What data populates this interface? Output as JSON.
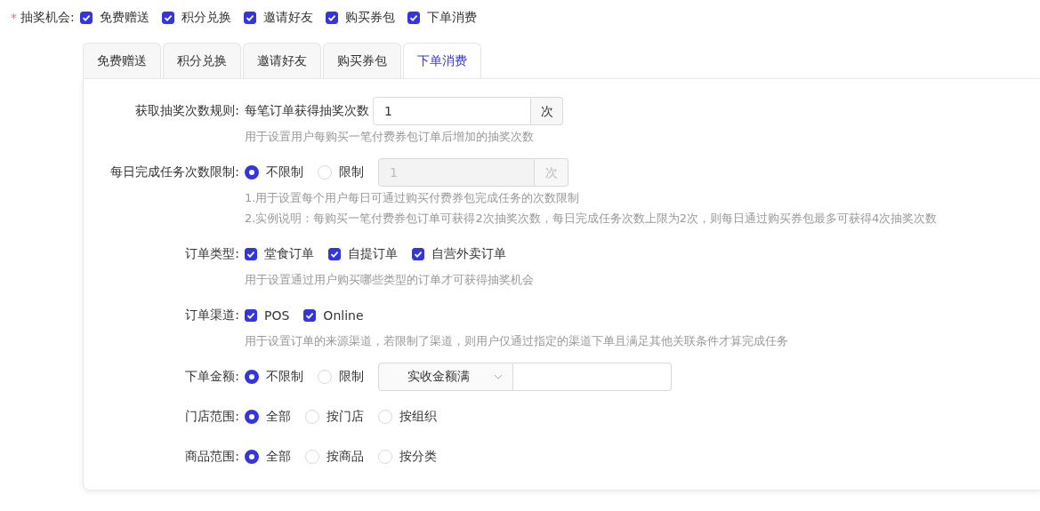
{
  "lottery": {
    "label": "抽奖机会:",
    "required_mark": "*",
    "options": [
      {
        "label": "免费赠送",
        "checked": true
      },
      {
        "label": "积分兑换",
        "checked": true
      },
      {
        "label": "邀请好友",
        "checked": true
      },
      {
        "label": "购买券包",
        "checked": true
      },
      {
        "label": "下单消费",
        "checked": true
      }
    ]
  },
  "tabs": [
    {
      "label": "免费赠送",
      "selected": false
    },
    {
      "label": "积分兑换",
      "selected": false
    },
    {
      "label": "邀请好友",
      "selected": false
    },
    {
      "label": "购买券包",
      "selected": false
    },
    {
      "label": "下单消费",
      "selected": true
    }
  ],
  "rows": [
    {
      "kind": "text",
      "label": "获取抽奖次数规则:",
      "prefix": "每笔订单获得抽奖次数",
      "input": {
        "value": "1",
        "suffix": "次",
        "disabled": false
      },
      "help": [
        "用于设置用户每购买一笔付费券包订单后增加的抽奖次数"
      ]
    },
    {
      "kind": "radio",
      "label": "每日完成任务次数限制:",
      "options": [
        {
          "label": "不限制",
          "selected": true
        },
        {
          "label": "限制",
          "selected": false
        }
      ],
      "input": {
        "value": "1",
        "suffix": "次",
        "disabled": true
      },
      "help": [
        "1.用于设置每个用户每日可通过购买付费券包完成任务的次数限制",
        "2.实例说明：每购买一笔付费券包订单可获得2次抽奖次数，每日完成任务次数上限为2次，则每日通过购买券包最多可获得4次抽奖次数"
      ]
    },
    {
      "kind": "checkbox",
      "label": "订单类型:",
      "options": [
        {
          "label": "堂食订单",
          "checked": true
        },
        {
          "label": "自提订单",
          "checked": true
        },
        {
          "label": "自营外卖订单",
          "checked": true
        }
      ],
      "help": [
        "用于设置通过用户购买哪些类型的订单才可获得抽奖机会"
      ]
    },
    {
      "kind": "checkbox",
      "label": "订单渠道:",
      "options": [
        {
          "label": "POS",
          "checked": true
        },
        {
          "label": "Online",
          "checked": true
        }
      ],
      "help": [
        "用于设置订单的来源渠道，若限制了渠道，则用户仅通过指定的渠道下单且满足其他关联条件才算完成任务"
      ]
    },
    {
      "kind": "radio",
      "label": "下单金额:",
      "options": [
        {
          "label": "不限制",
          "selected": true
        },
        {
          "label": "限制",
          "selected": false
        }
      ],
      "select": {
        "value": "实收金额满"
      },
      "amount": {
        "disabled": false
      }
    },
    {
      "kind": "radio",
      "label": "门店范围:",
      "options": [
        {
          "label": "全部",
          "selected": true
        },
        {
          "label": "按门店",
          "selected": false
        },
        {
          "label": "按组织",
          "selected": false
        }
      ]
    },
    {
      "kind": "radio",
      "label": "商品范围:",
      "options": [
        {
          "label": "全部",
          "selected": true
        },
        {
          "label": "按商品",
          "selected": false
        },
        {
          "label": "按分类",
          "selected": false
        }
      ]
    }
  ]
}
